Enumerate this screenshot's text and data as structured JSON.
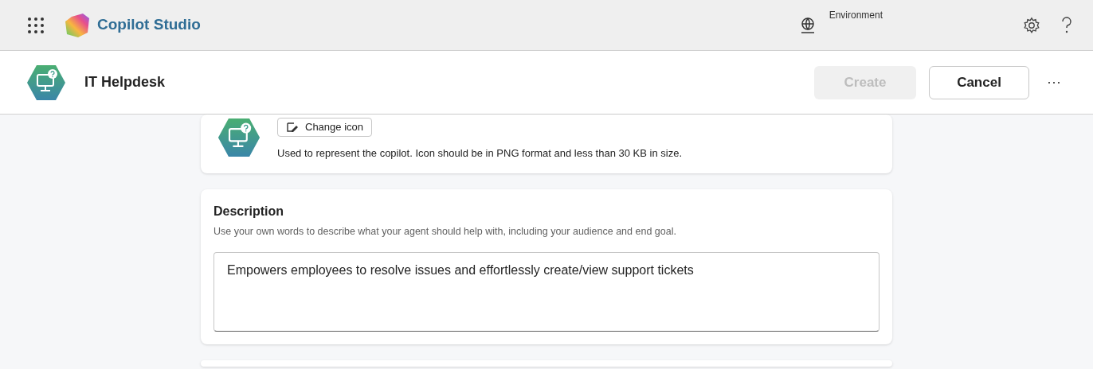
{
  "app_bar": {
    "title": "Copilot Studio",
    "environment_label": "Environment"
  },
  "header": {
    "title": "IT Helpdesk",
    "buttons": [
      {
        "label": "Create",
        "kind": "primary",
        "disabled": true
      },
      {
        "label": "Cancel",
        "kind": "secondary",
        "disabled": false
      }
    ],
    "more": "···"
  },
  "icon_card": {
    "button": "Change icon",
    "hint": "Used to represent the copilot. Icon should be in PNG format and less than 30 KB in size."
  },
  "description_card": {
    "title": "Description",
    "hint": "Use your own words to describe what your agent should help with, including your audience and end goal.",
    "value": "Empowers employees to resolve issues and effortlessly create/view support tickets"
  }
}
